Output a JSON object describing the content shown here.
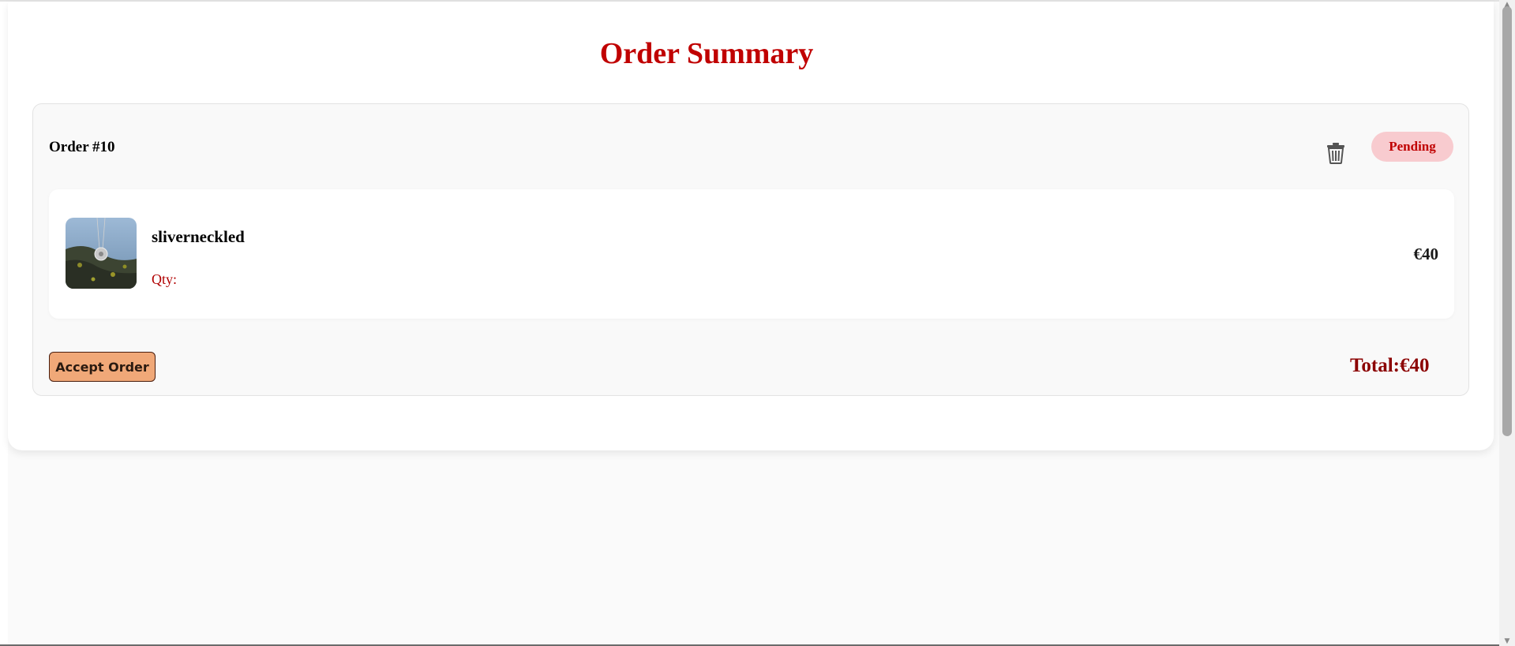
{
  "page": {
    "title": "Order Summary"
  },
  "order": {
    "id_label": "Order #10",
    "status": "Pending",
    "items": [
      {
        "name": "sliverneckled",
        "qty_label": "Qty:",
        "price": "€40",
        "image_icon": "necklace-photo"
      }
    ],
    "accept_label": "Accept Order",
    "total_label": "Total:€40"
  },
  "icons": {
    "delete": "trash-icon"
  },
  "colors": {
    "title": "#c00000",
    "status_bg": "#f8cbcf",
    "status_text": "#c00000",
    "accept_bg": "#f0a878",
    "total": "#8b0000"
  }
}
